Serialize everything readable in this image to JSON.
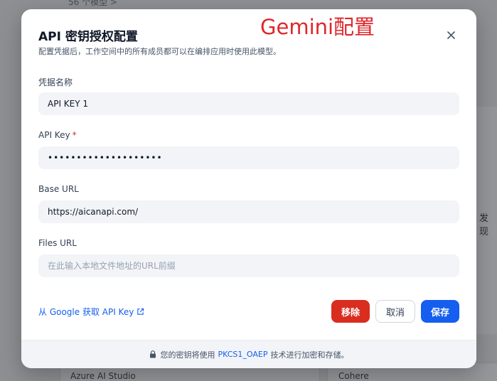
{
  "background": {
    "top_text": "56 个模型 >",
    "card_left_label": "Azure AI Studio",
    "card_right_label": "Cohere",
    "side_text": "发现"
  },
  "annotation": "Gemini配置",
  "modal": {
    "title": "API 密钥授权配置",
    "subtitle": "配置凭据后，工作空间中的所有成员都可以在编排应用时使用此模型。",
    "fields": {
      "credential_name": {
        "label": "凭据名称",
        "value": "API KEY 1",
        "placeholder": ""
      },
      "api_key": {
        "label": "API Key",
        "required_mark": "*",
        "value": "••••••••••••••••••••",
        "placeholder": ""
      },
      "base_url": {
        "label": "Base URL",
        "value": "https://aicanapi.com/",
        "placeholder": ""
      },
      "files_url": {
        "label": "Files URL",
        "value": "",
        "placeholder": "在此输入本地文件地址的URL前缀"
      }
    },
    "help_link": "从 Google 获取 API Key",
    "buttons": {
      "remove": "移除",
      "cancel": "取消",
      "save": "保存"
    },
    "footer": {
      "before": "您的密钥将使用",
      "link": "PKCS1_OAEP",
      "after": "技术进行加密和存储。"
    }
  },
  "colors": {
    "primary": "#155eef",
    "danger": "#d92d20",
    "annotation": "#e0262b"
  }
}
